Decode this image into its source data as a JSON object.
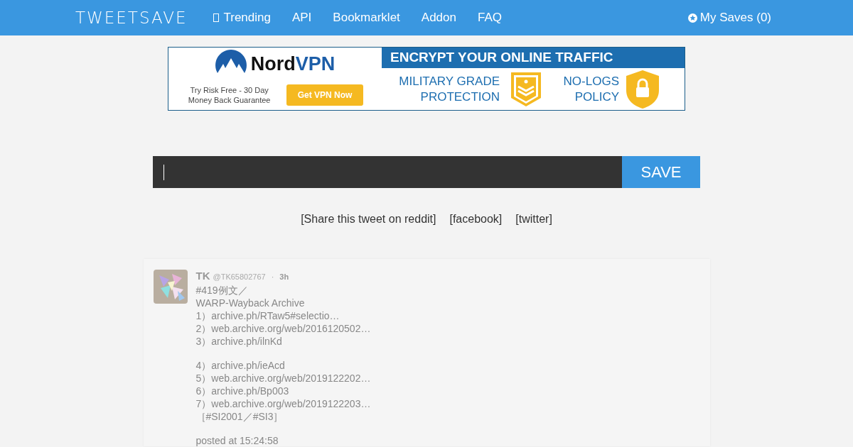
{
  "navbar": {
    "logo": "TWEETSAVE",
    "links": [
      {
        "label": "Trending",
        "icon": true
      },
      {
        "label": "API",
        "icon": false
      },
      {
        "label": "Bookmarklet",
        "icon": false
      },
      {
        "label": "Addon",
        "icon": false
      },
      {
        "label": "FAQ",
        "icon": false
      }
    ],
    "saves": "My Saves (0)"
  },
  "ad": {
    "brand_a": "Nord",
    "brand_b": "VPN",
    "tagline": "Try Risk Free - 30 Day Money Back Guarantee",
    "cta": "Get VPN Now",
    "headline": "ENCRYPT YOUR ONLINE TRAFFIC",
    "feature_1": "MILITARY GRADE PROTECTION",
    "feature_2": "NO-LOGS POLICY"
  },
  "save_form": {
    "button": "SAVE"
  },
  "share_links": [
    "[Share this tweet on reddit]",
    "[facebook]",
    "[twitter]"
  ],
  "tweet": {
    "name": "TK",
    "handle": "@TK65802767",
    "separator": "·",
    "age": "3h",
    "paragraphs": [
      [
        "#419例文／",
        "WARP-Wayback Archive",
        "1）archive.ph/RTaw5#selectio…",
        "2）web.archive.org/web/2016120502…",
        "3）archive.ph/ilnKd"
      ],
      [
        "4）archive.ph/ieAcd",
        "5）web.archive.org/web/2019122202…",
        "6）archive.ph/Bp003",
        "7）web.archive.org/web/2019122203…",
        "［#SI2001／#SI3］"
      ]
    ],
    "posted": "posted at 15:24:58"
  }
}
